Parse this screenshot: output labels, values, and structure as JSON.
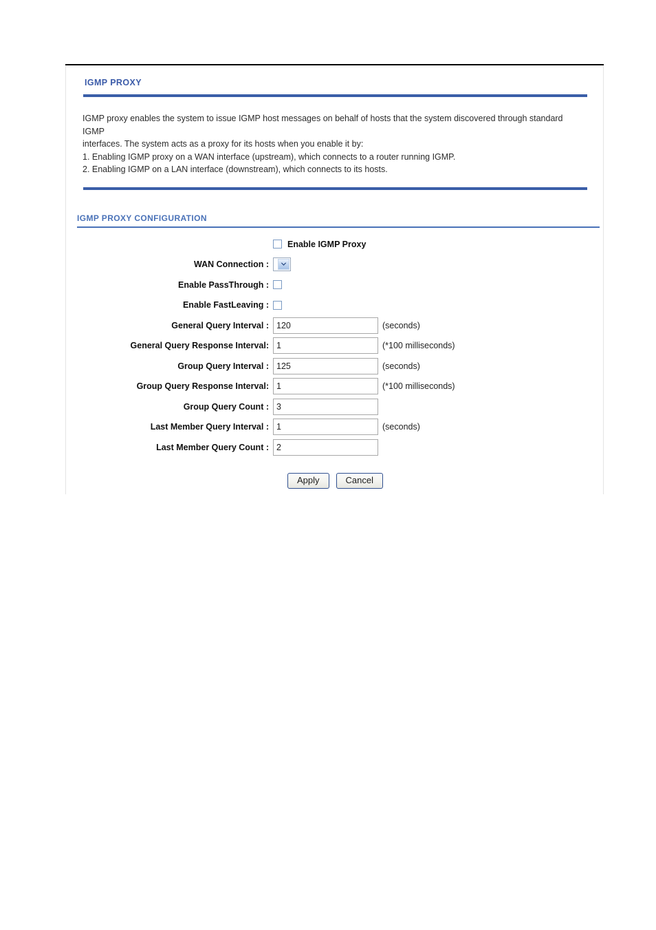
{
  "page": {
    "title": "IGMP PROXY",
    "accent_dark_blue": "#3b5ba9",
    "accent_light_blue": "#4a72b8",
    "divider_blue": "#3a5ea8"
  },
  "intro": {
    "line1": "IGMP proxy enables the system to issue IGMP host messages on behalf of hosts that the system discovered through standard IGMP",
    "line2": "interfaces. The system acts as a proxy for its hosts when you enable it by:",
    "item1": "1. Enabling IGMP proxy on a WAN interface (upstream), which connects to a router running IGMP.",
    "item2": "2. Enabling IGMP on a LAN interface (downstream), which connects to its hosts."
  },
  "config": {
    "heading": "IGMP PROXY CONFIGURATION",
    "enable_proxy": {
      "label": "Enable IGMP Proxy",
      "checked": false,
      "icon": "checkbox-unchecked"
    },
    "rows": [
      {
        "label": "WAN Connection :",
        "type": "select",
        "value": "",
        "unit": "",
        "icon": "chevron-down-icon"
      },
      {
        "label": "Enable PassThrough :",
        "type": "checkbox",
        "value": "",
        "unit": "",
        "icon": "checkbox-unchecked"
      },
      {
        "label": "Enable FastLeaving :",
        "type": "checkbox",
        "value": "",
        "unit": "",
        "icon": "checkbox-unchecked"
      },
      {
        "label": "General Query Interval :",
        "type": "text",
        "value": "120",
        "unit": "(seconds)"
      },
      {
        "label": "General Query Response Interval:",
        "type": "text",
        "value": "1",
        "unit": "(*100 milliseconds)"
      },
      {
        "label": "Group Query Interval :",
        "type": "text",
        "value": "125",
        "unit": "(seconds)"
      },
      {
        "label": "Group Query Response Interval:",
        "type": "text",
        "value": "1",
        "unit": "(*100 milliseconds)"
      },
      {
        "label": "Group Query Count :",
        "type": "text",
        "value": "3",
        "unit": ""
      },
      {
        "label": "Last Member Query Interval :",
        "type": "text",
        "value": "1",
        "unit": "(seconds)"
      },
      {
        "label": "Last Member Query Count :",
        "type": "text",
        "value": "2",
        "unit": ""
      }
    ]
  },
  "buttons": {
    "apply": "Apply",
    "cancel": "Cancel"
  }
}
